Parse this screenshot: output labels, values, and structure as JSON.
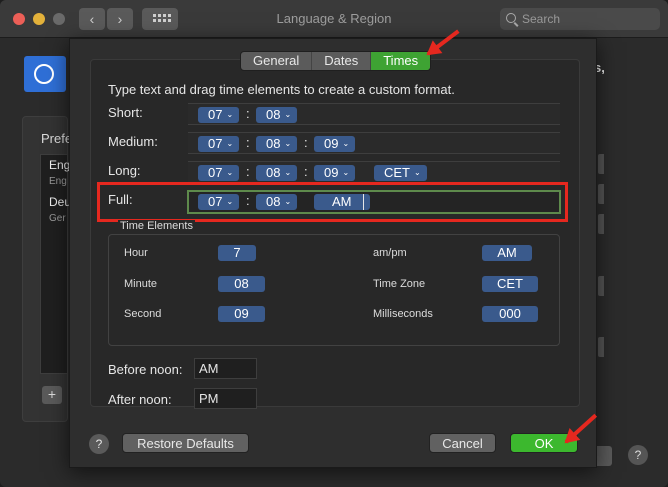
{
  "window": {
    "title": "Language & Region",
    "back": "‹",
    "forward": "›",
    "search_placeholder": "Search"
  },
  "background": {
    "comma_fragment": "s,",
    "preferred_label": "Prefe",
    "list_items": [
      {
        "title": "Eng",
        "sub": "Eng"
      },
      {
        "title": "Deu",
        "sub": "Ger"
      }
    ],
    "add_label": "+",
    "help_label": "?"
  },
  "tabs": [
    {
      "label": "General",
      "active": false
    },
    {
      "label": "Dates",
      "active": false
    },
    {
      "label": "Times",
      "active": true
    }
  ],
  "instructions": "Type text and drag time elements to create a custom format.",
  "formats": {
    "short": {
      "label": "Short:",
      "tokens": [
        "07",
        "08"
      ]
    },
    "medium": {
      "label": "Medium:",
      "tokens": [
        "07",
        "08",
        "09"
      ]
    },
    "long": {
      "label": "Long:",
      "tokens": [
        "07",
        "08",
        "09",
        "CET"
      ]
    },
    "full": {
      "label": "Full:",
      "tokens": [
        "07",
        "08",
        "AM"
      ]
    }
  },
  "separator": ":",
  "time_elements": {
    "title": "Time Elements",
    "hour": {
      "label": "Hour",
      "value": "7"
    },
    "minute": {
      "label": "Minute",
      "value": "08"
    },
    "second": {
      "label": "Second",
      "value": "09"
    },
    "ampm": {
      "label": "am/pm",
      "value": "AM"
    },
    "timezone": {
      "label": "Time Zone",
      "value": "CET"
    },
    "milliseconds": {
      "label": "Milliseconds",
      "value": "000"
    }
  },
  "before_noon": {
    "label": "Before noon:",
    "value": "AM"
  },
  "after_noon": {
    "label": "After noon:",
    "value": "PM"
  },
  "buttons": {
    "help": "?",
    "restore_defaults": "Restore Defaults",
    "cancel": "Cancel",
    "ok": "OK"
  },
  "colors": {
    "active_tab": "#3ea333",
    "token": "#3a5a8c",
    "ok_button": "#3cb82e",
    "annotation": "#e5281f"
  }
}
